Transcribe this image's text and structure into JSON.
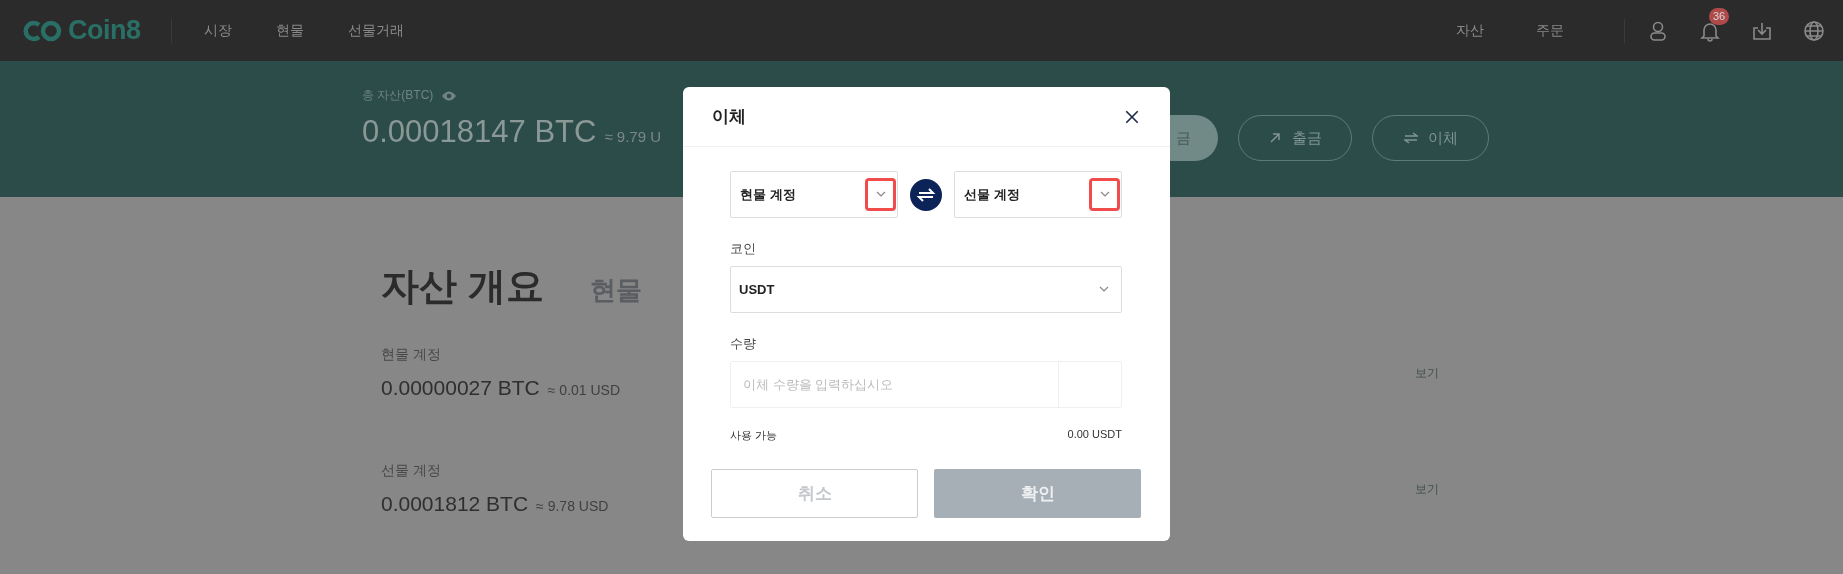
{
  "header": {
    "logo": "Coin8",
    "nav": [
      "시장",
      "현물",
      "선물거래"
    ],
    "right_nav": [
      "자산",
      "주문"
    ],
    "notification_badge": "36"
  },
  "banner": {
    "label": "총 자산(BTC)",
    "total": "0.00018147 BTC",
    "approx": "≈ 9.79 U",
    "buttons": [
      {
        "kind": "deposit",
        "label": "금"
      },
      {
        "kind": "withdraw",
        "label": "출금"
      },
      {
        "kind": "transfer",
        "label": "이체"
      }
    ]
  },
  "overview": {
    "title": "자산 개요",
    "tab": "현물",
    "accounts": [
      {
        "name": "현물 계정",
        "balance": "0.00000027 BTC",
        "approx": "≈ 0.01 USD",
        "action": "보기"
      },
      {
        "name": "선물 계정",
        "balance": "0.0001812 BTC",
        "approx": "≈ 9.78 USD",
        "action": "보기"
      }
    ]
  },
  "dialog": {
    "title": "이체",
    "from": {
      "value": "현물 계정",
      "highlighted": true
    },
    "to": {
      "value": "선물 계정",
      "highlighted": true
    },
    "coin_label": "코인",
    "coin": "USDT",
    "amount_label": "수량",
    "amount_placeholder": "이체 수량을 입력하십시오",
    "available_label": "사용 가능",
    "available": "0.00 USDT",
    "buttons": [
      {
        "kind": "cancel",
        "label": "취소",
        "disabled": true
      },
      {
        "kind": "confirm",
        "label": "확인",
        "disabled": true
      }
    ]
  }
}
